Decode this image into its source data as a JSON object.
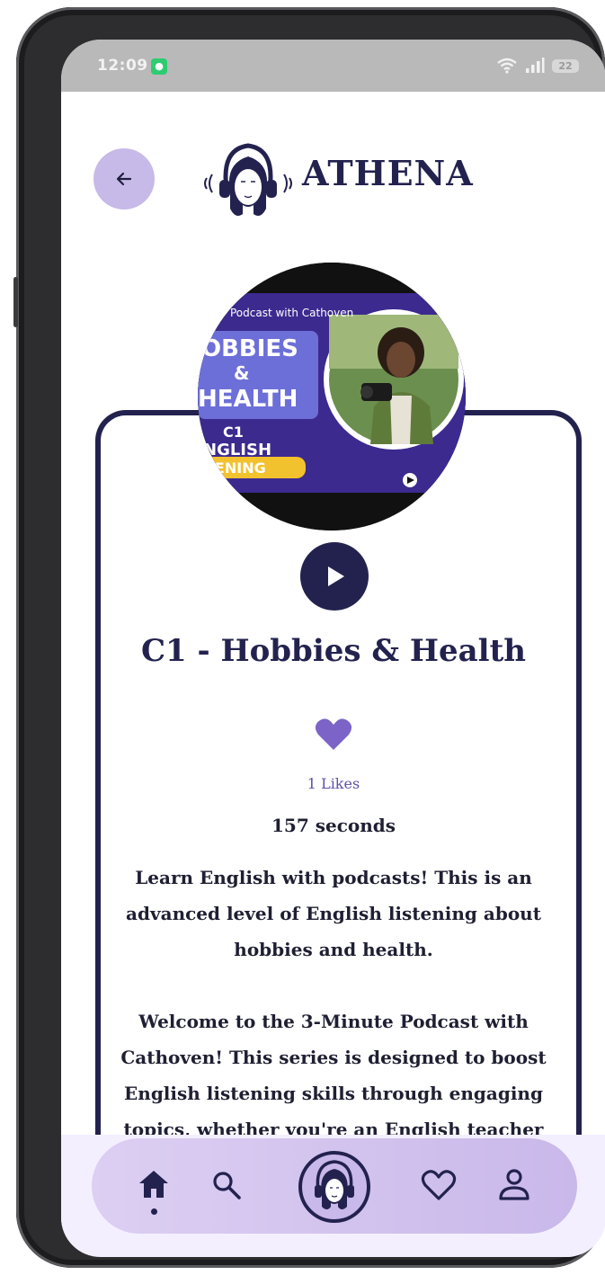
{
  "status_bar": {
    "time": "12:09",
    "battery": "22",
    "icons": [
      "messenger-app-icon",
      "wifi-icon",
      "signal-icon",
      "battery-icon"
    ]
  },
  "header": {
    "brand": "ATHENA",
    "back_icon": "arrow-left-icon",
    "logo_icon": "headphones-woman-logo"
  },
  "cover": {
    "subtitle": "Podcast with Cathoven",
    "line1": "OBBIES",
    "line2": "&",
    "line3": "HEALTH",
    "level": "C1",
    "line4": "NGLISH",
    "line5": "TENING"
  },
  "podcast": {
    "title": "C1 - Hobbies & Health",
    "likes": "1 Likes",
    "duration": "157 seconds",
    "description": "Learn English with podcasts! This is an advanced level of English listening about hobbies and health.\n\nWelcome to the 3-Minute Podcast with Cathoven! This series is designed to boost English listening skills through engaging topics, whether you're an English teacher"
  },
  "nav": {
    "items": [
      "home-icon",
      "search-icon",
      "athena-logo-icon",
      "heart-outline-icon",
      "person-icon"
    ],
    "active": "home"
  },
  "colors": {
    "primary": "#23224f",
    "accent": "#c7b9e8",
    "heart": "#7b63c7"
  }
}
